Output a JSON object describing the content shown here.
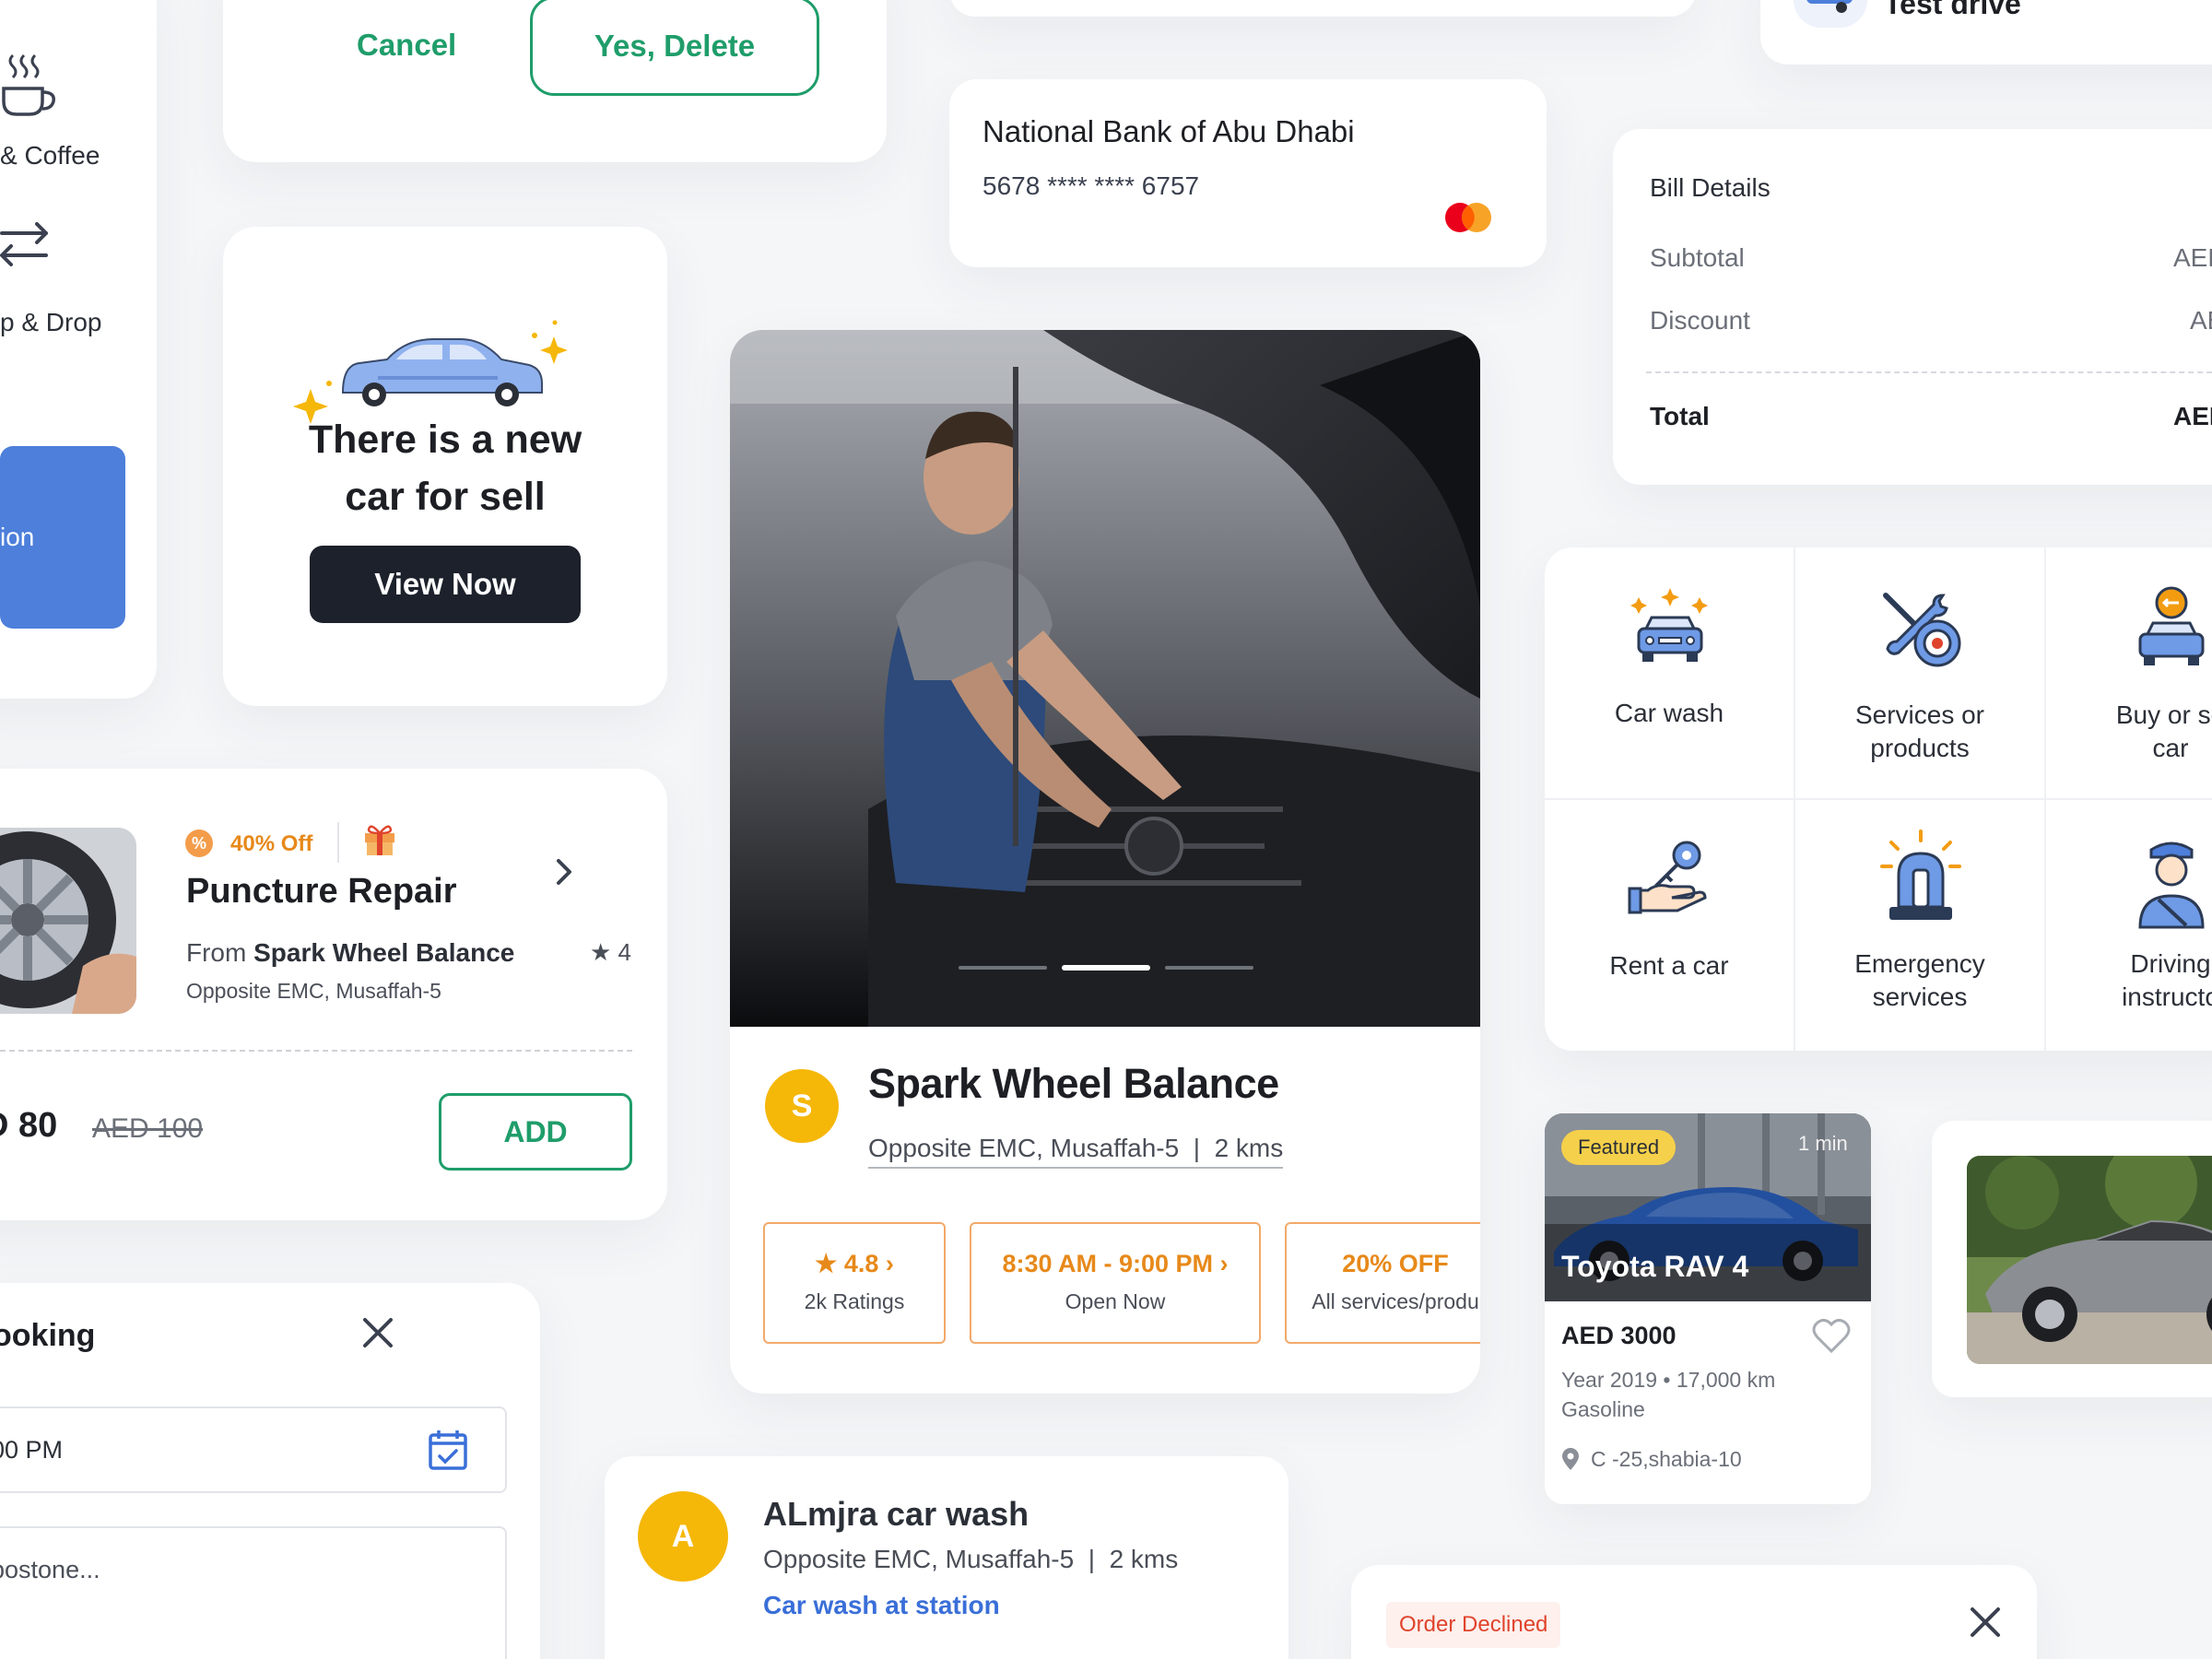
{
  "sidebar": {
    "coffee_label": "& Coffee",
    "dropoff_label": "p & Drop",
    "active_label": "ion"
  },
  "delete_dialog": {
    "cancel": "Cancel",
    "confirm": "Yes, Delete"
  },
  "new_car": {
    "title_line1": "There is a new",
    "title_line2": "car for sell",
    "button": "View Now"
  },
  "bank_card": {
    "bank": "National Bank of Abu Dhabi",
    "number": "5678 **** **** 6757"
  },
  "test_drive": {
    "label": "Test drive"
  },
  "bill": {
    "title": "Bill Details",
    "rows": [
      {
        "label": "Subtotal",
        "value": "AED"
      },
      {
        "label": "Discount",
        "value": "AE"
      }
    ],
    "total_label": "Total",
    "total_value": "AED"
  },
  "services": [
    {
      "label1": "Car wash",
      "label2": "",
      "icon": "car-wash-icon"
    },
    {
      "label1": "Services or",
      "label2": "products",
      "icon": "tools-wheel-icon"
    },
    {
      "label1": "Buy or se",
      "label2": "car",
      "icon": "buy-sell-car-icon"
    },
    {
      "label1": "Rent a car",
      "label2": "",
      "icon": "rent-key-icon"
    },
    {
      "label1": "Emergency",
      "label2": "services",
      "icon": "siren-icon"
    },
    {
      "label1": "Driving",
      "label2": "instructo",
      "icon": "instructor-icon"
    }
  ],
  "offer": {
    "badge": "40% Off",
    "title": "Puncture Repair",
    "from_prefix": "From",
    "from_name": "Spark Wheel Balance",
    "rating": "4",
    "address": "Opposite EMC, Musaffah-5",
    "price": "D 80",
    "old_price": "AED 100",
    "add": "ADD"
  },
  "shop": {
    "avatar": "S",
    "name": "Spark Wheel Balance",
    "address": "Opposite EMC, Musaffah-5  |  2 kms",
    "rating_value": "4.8",
    "rating_label": "2k Ratings",
    "hours_value": "8:30 AM - 9:00 PM",
    "hours_label": "Open Now",
    "discount_value": "20% OFF",
    "discount_label": "All services/produ",
    "carousel_active": 2,
    "carousel_total": 3
  },
  "listing": {
    "featured": "Featured",
    "time": "1 min",
    "title": "Toyota RAV 4",
    "price": "AED 3000",
    "meta": "Year 2019 • 17,000 km",
    "fuel": "Gasoline",
    "location": "C -25,shabia-10"
  },
  "booking": {
    "title": "ooking",
    "time_value": "00 PM",
    "notes_value": "postone..."
  },
  "car_wash": {
    "avatar": "A",
    "name": "ALmjra car wash",
    "address": "Opposite EMC, Musaffah-5  |  2 kms",
    "type": "Car wash at station"
  },
  "order": {
    "status": "Order Declined"
  },
  "colors": {
    "green": "#1f9d6a",
    "orange": "#e7891a",
    "blue": "#3a6fd8",
    "dark": "#1d1f24",
    "yellow": "#f5b708",
    "red": "#e0432c"
  }
}
